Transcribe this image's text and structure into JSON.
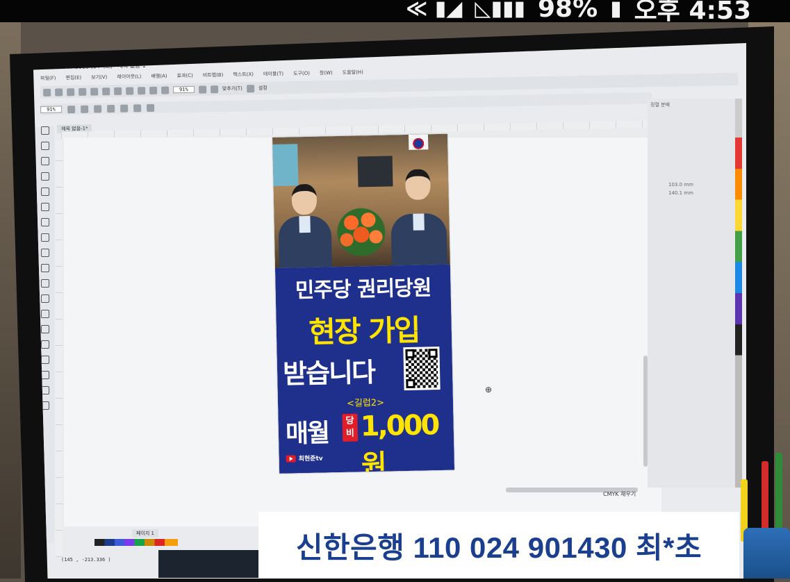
{
  "status_bar": {
    "battery": "98%",
    "time": "오후 4:53"
  },
  "app": {
    "title": "CorelDRAW 2018 (64비트) - 제목 없음-1*",
    "menu": [
      "파일(F)",
      "편집(E)",
      "보기(V)",
      "레이아웃(L)",
      "배열(A)",
      "효과(C)",
      "비트맵(B)",
      "텍스트(X)",
      "테이블(T)",
      "도구(O)",
      "창(W)",
      "도움말(H)"
    ],
    "zoom_main": "91%",
    "zoom_prop": "91%",
    "snap_label": "맞추기(T)",
    "settings_label": "설정",
    "doc_tab": "제목 없음-1*",
    "page_tab": "페이지 1",
    "docker_title": "정렬 분배",
    "docker_values": [
      "103.0 mm",
      "140.1 mm"
    ],
    "coords": "(145 , -213.336 )",
    "tray_label": "CMYK 채우기"
  },
  "poster": {
    "line1": "민주당 권리당원",
    "line2": "현장 가입",
    "line3": "받습니다",
    "line4": "<길럽2>",
    "line5": "매월",
    "badge_top": "당",
    "badge_bottom": "비",
    "line6": "1,000원",
    "channel": "최현준tv"
  },
  "caption": {
    "text": "신한은행 110 024 901430 최*초"
  },
  "colors": {
    "poster_blue": "#1f2f8c",
    "poster_yellow": "#ffe400",
    "caption_text": "#1b3f8f"
  }
}
